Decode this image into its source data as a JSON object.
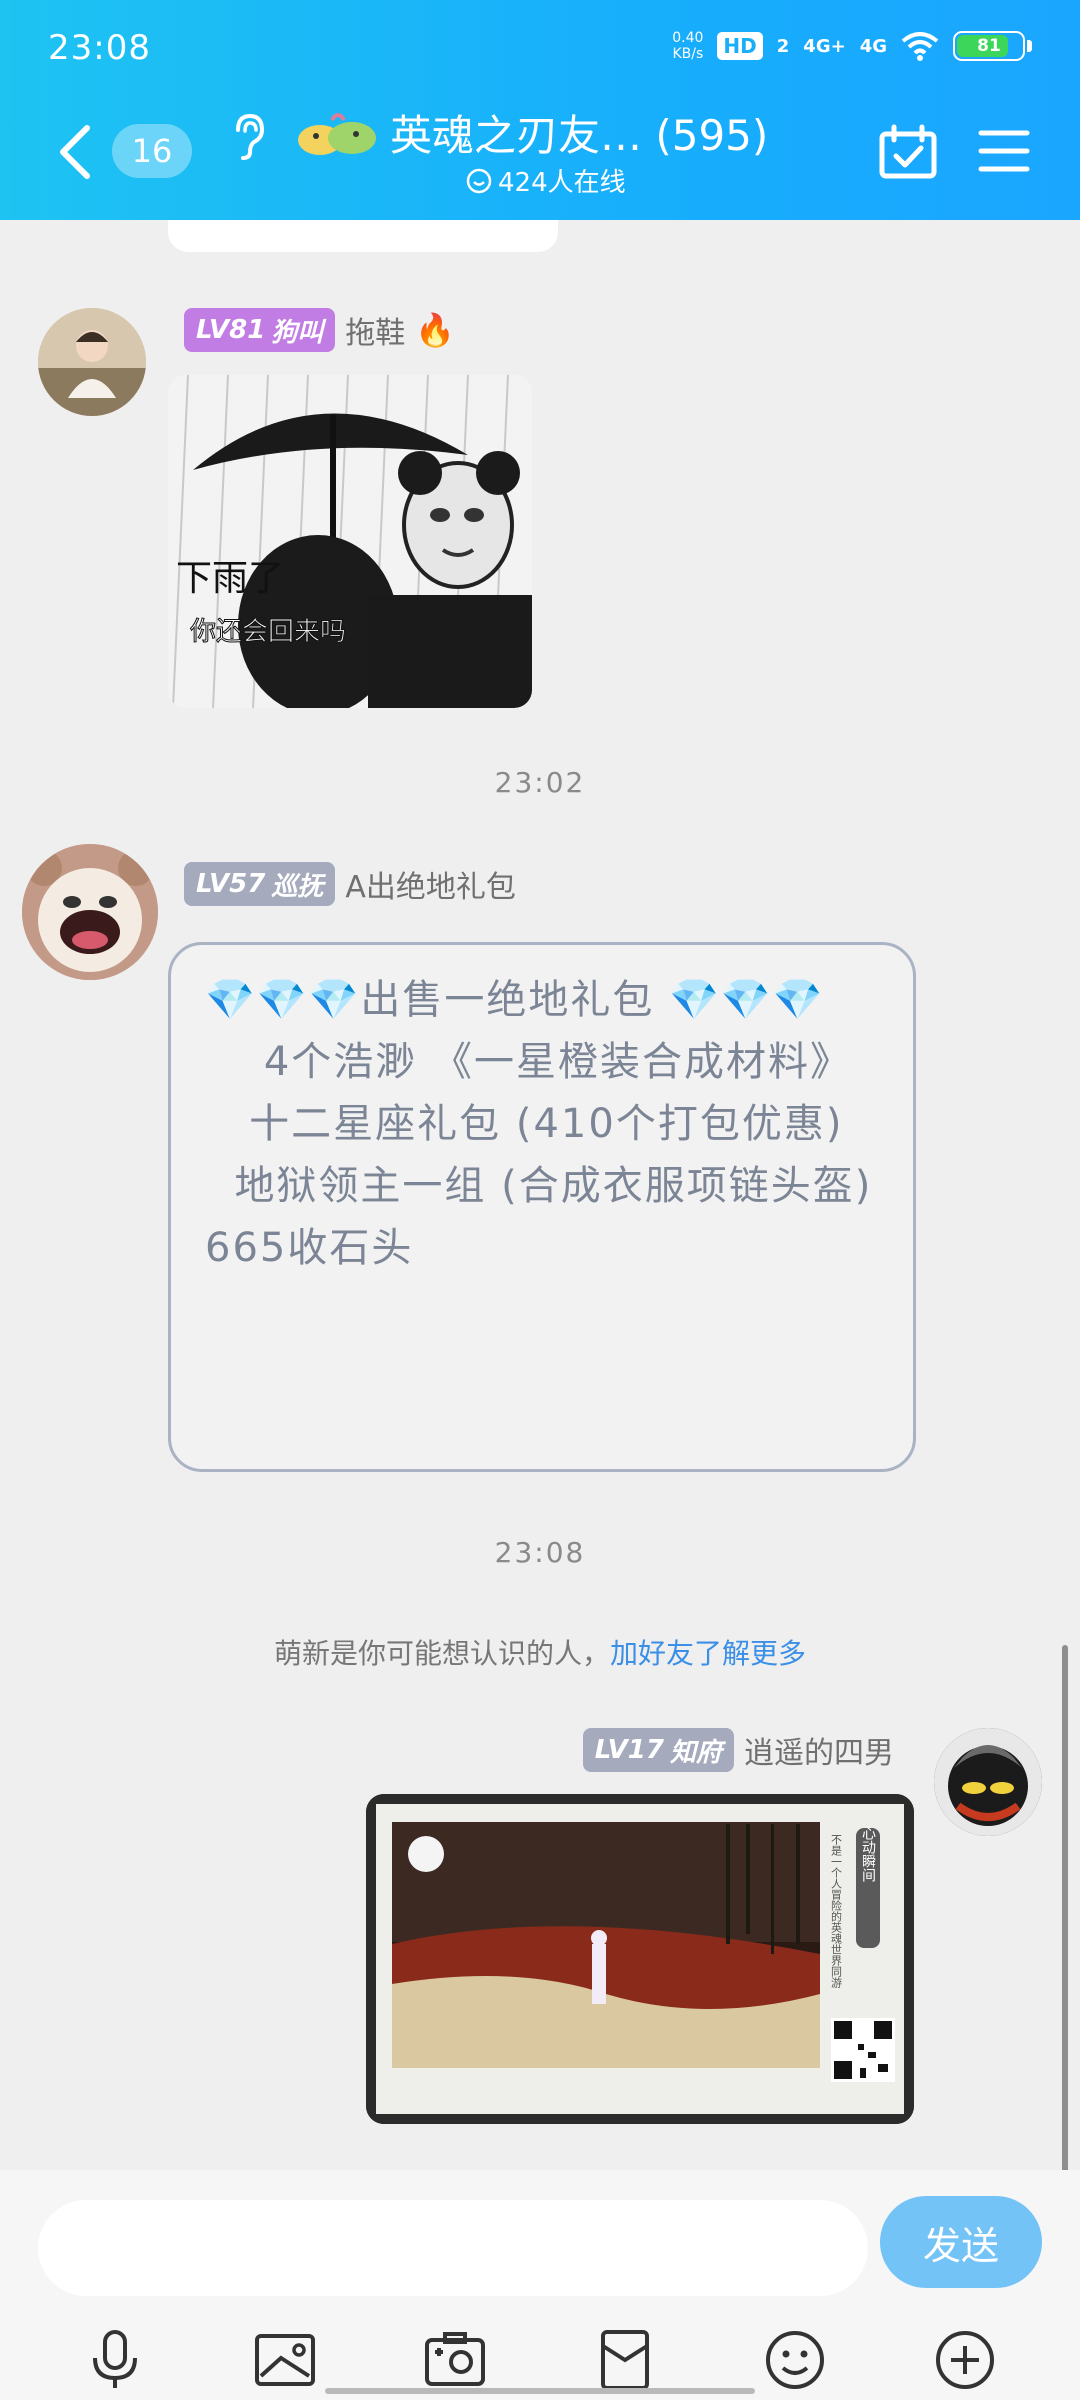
{
  "status_bar": {
    "time": "23:08",
    "net_speed_value": "0.40",
    "net_speed_unit": "KB/s",
    "hd_label": "HD",
    "hd_sub": "2",
    "signal_1": "4G+",
    "signal_2": "4G",
    "battery": "81",
    "battery_level": 0.81
  },
  "header": {
    "unread_count": "16",
    "group_name": "英魂之刃友… (595)",
    "online_count": "424人在线"
  },
  "messages": {
    "msg1": {
      "level": "LV81",
      "title": "狗叫",
      "sender_name": "拖鞋",
      "sticker_caption_1": "下雨了",
      "sticker_caption_2": "你还会回来吗"
    },
    "time_1": "23:02",
    "msg2": {
      "level": "LV57",
      "title": "巡抚",
      "sender_name": "A出绝地礼包",
      "lines": [
        "💎💎💎出售一绝地礼包 💎💎💎",
        "    4个浩渺 《一星橙装合成材料》",
        "   十二星座礼包 (410个打包优惠)",
        "  地狱领主一组 (合成衣服项链头盔)",
        "665收石头"
      ]
    },
    "time_2": "23:08",
    "notice_text": "萌新是你可能想认识的人，",
    "notice_link": "加好友了解更多",
    "msg3": {
      "level": "LV17",
      "title": "知府",
      "sender_name": "逍遥的四男",
      "card_side_text": "心动瞬间",
      "card_caption": "不是一个人冒险的英魂世界同游"
    }
  },
  "composer": {
    "input_placeholder": "",
    "send_label": "发送"
  },
  "colors": {
    "header_start": "#1ec3f2",
    "header_end": "#1aa6ff",
    "badge_lv81": "#c17de4",
    "badge_lv57": "#a5abbd",
    "badge_lv17": "#a5abbd",
    "link": "#3b8fe6",
    "send_button": "#73c3f6"
  },
  "toolbar": {
    "icons": [
      "microphone-icon",
      "image-icon",
      "camera-icon",
      "red-packet-icon",
      "emoji-icon",
      "plus-icon"
    ]
  }
}
